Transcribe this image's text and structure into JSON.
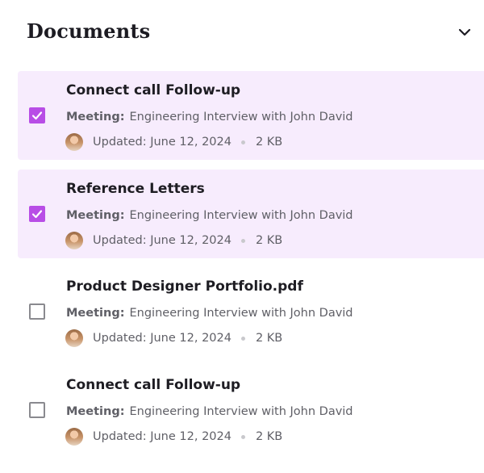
{
  "section": {
    "title": "Documents",
    "collapse_icon": "chevron-down-icon"
  },
  "colors": {
    "accent": "#b84de6",
    "selected_background": "#f7ecfd"
  },
  "documents": [
    {
      "title": "Connect call Follow-up",
      "selected": true,
      "meeting_label": "Meeting:",
      "meeting": "Engineering Interview with John David",
      "updated": "Updated: June 12, 2024",
      "size": "2 KB"
    },
    {
      "title": "Reference Letters",
      "selected": true,
      "meeting_label": "Meeting:",
      "meeting": "Engineering Interview with John David",
      "updated": "Updated: June 12, 2024",
      "size": "2 KB"
    },
    {
      "title": "Product Designer Portfolio.pdf",
      "selected": false,
      "meeting_label": "Meeting:",
      "meeting": "Engineering Interview with John David",
      "updated": "Updated: June 12, 2024",
      "size": "2 KB"
    },
    {
      "title": "Connect call Follow-up",
      "selected": false,
      "meeting_label": "Meeting:",
      "meeting": "Engineering Interview with John David",
      "updated": "Updated: June 12, 2024",
      "size": "2 KB"
    }
  ]
}
